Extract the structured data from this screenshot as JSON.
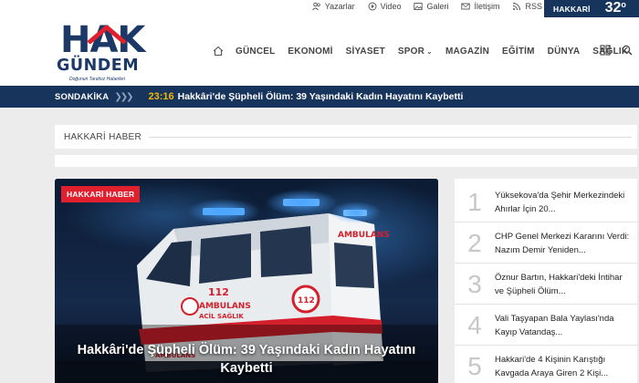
{
  "topbar": {
    "links": [
      {
        "label": "Yazarlar",
        "icon": "users-icon"
      },
      {
        "label": "Video",
        "icon": "play-icon"
      },
      {
        "label": "Galeri",
        "icon": "image-icon"
      },
      {
        "label": "İletişim",
        "icon": "mail-icon"
      },
      {
        "label": "RSS",
        "icon": "rss-icon"
      }
    ],
    "weather": {
      "city": "HAKKARİ",
      "temp": "32",
      "unit": "o"
    }
  },
  "logo": {
    "line1": "HAK",
    "line2": "GÜNDEM",
    "slogan": "Doğunun Tarafsız Haberleri"
  },
  "nav": {
    "items": [
      "GÜNCEL",
      "EKONOMİ",
      "SİYASET",
      "SPOR",
      "MAGAZİN",
      "EĞİTİM",
      "DÜNYA",
      "SAĞLIK"
    ],
    "spor_chevron": "⌄"
  },
  "breaking": {
    "label": "SONDAKİKA",
    "arrows": "❯❯❯",
    "time": "23:16",
    "headline": "Hakkâri'de Şüpheli Ölüm: 39 Yaşındaki Kadın Hayatını Kaybetti"
  },
  "section": {
    "title": "HAKKARİ HABER"
  },
  "feature": {
    "badge": "HAKKARİ HABER",
    "title": "Hakkâri'de Şüpheli Ölüm: 39 Yaşındaki Kadın Hayatını Kaybetti",
    "ambulance": {
      "front_text": "AMBULANS",
      "side_number": "112",
      "side_line1": "AMBULANS",
      "side_line2": "ACİL SAĞLIK",
      "lower_text": "AMBULANS",
      "rear_number": "112"
    }
  },
  "list": [
    {
      "num": "1",
      "text": "Yüksekova'da Şehir Merkezindeki Ahırlar İçin 20..."
    },
    {
      "num": "2",
      "text": "CHP Genel Merkezi Kararını Verdi: Nazım Demir Yeniden..."
    },
    {
      "num": "3",
      "text": "Öznur Bartın, Hakkari'deki İntihar ve Şüpheli Ölüm..."
    },
    {
      "num": "4",
      "text": "Vali Taşyapan Bala Yaylası'nda Kayıp Vatandaş..."
    },
    {
      "num": "5",
      "text": "Hakkari'de 4 Kişinin Karıştığı Kavgada Araya Giren 2 Kişi..."
    }
  ],
  "colors": {
    "navy": "#17345c",
    "red": "#e0202e",
    "gold": "#f2b705"
  }
}
